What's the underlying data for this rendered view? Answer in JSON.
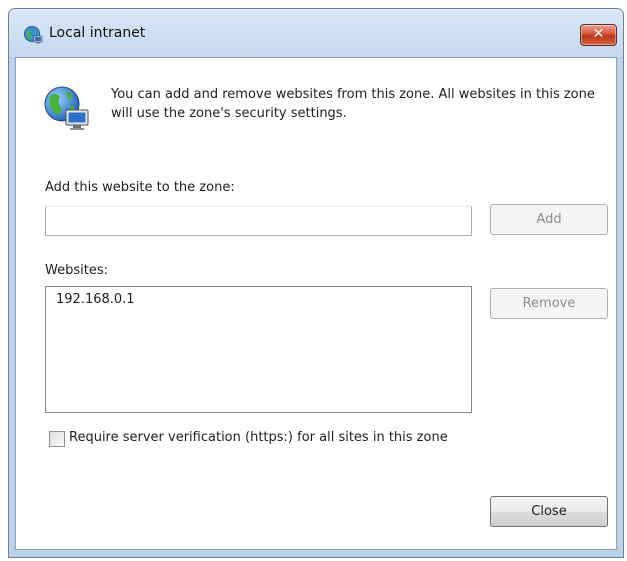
{
  "window": {
    "title": "Local intranet",
    "close_glyph": "✕"
  },
  "info": {
    "text": "You can add and remove websites from this zone. All websites in this zone will use the zone's security settings.",
    "icon": "intranet-globe-icon"
  },
  "add": {
    "label": "Add this website to the zone:",
    "value": "",
    "button_label": "Add",
    "button_enabled": false
  },
  "websites": {
    "label": "Websites:",
    "items": [
      "192.168.0.1"
    ],
    "remove_label": "Remove",
    "remove_enabled": false
  },
  "verification": {
    "label": "Require server verification (https:) for all sites in this zone",
    "checked": false
  },
  "footer": {
    "close_label": "Close"
  },
  "colors": {
    "title_bar": "#c4d8ef",
    "close_button": "#c7432a"
  }
}
